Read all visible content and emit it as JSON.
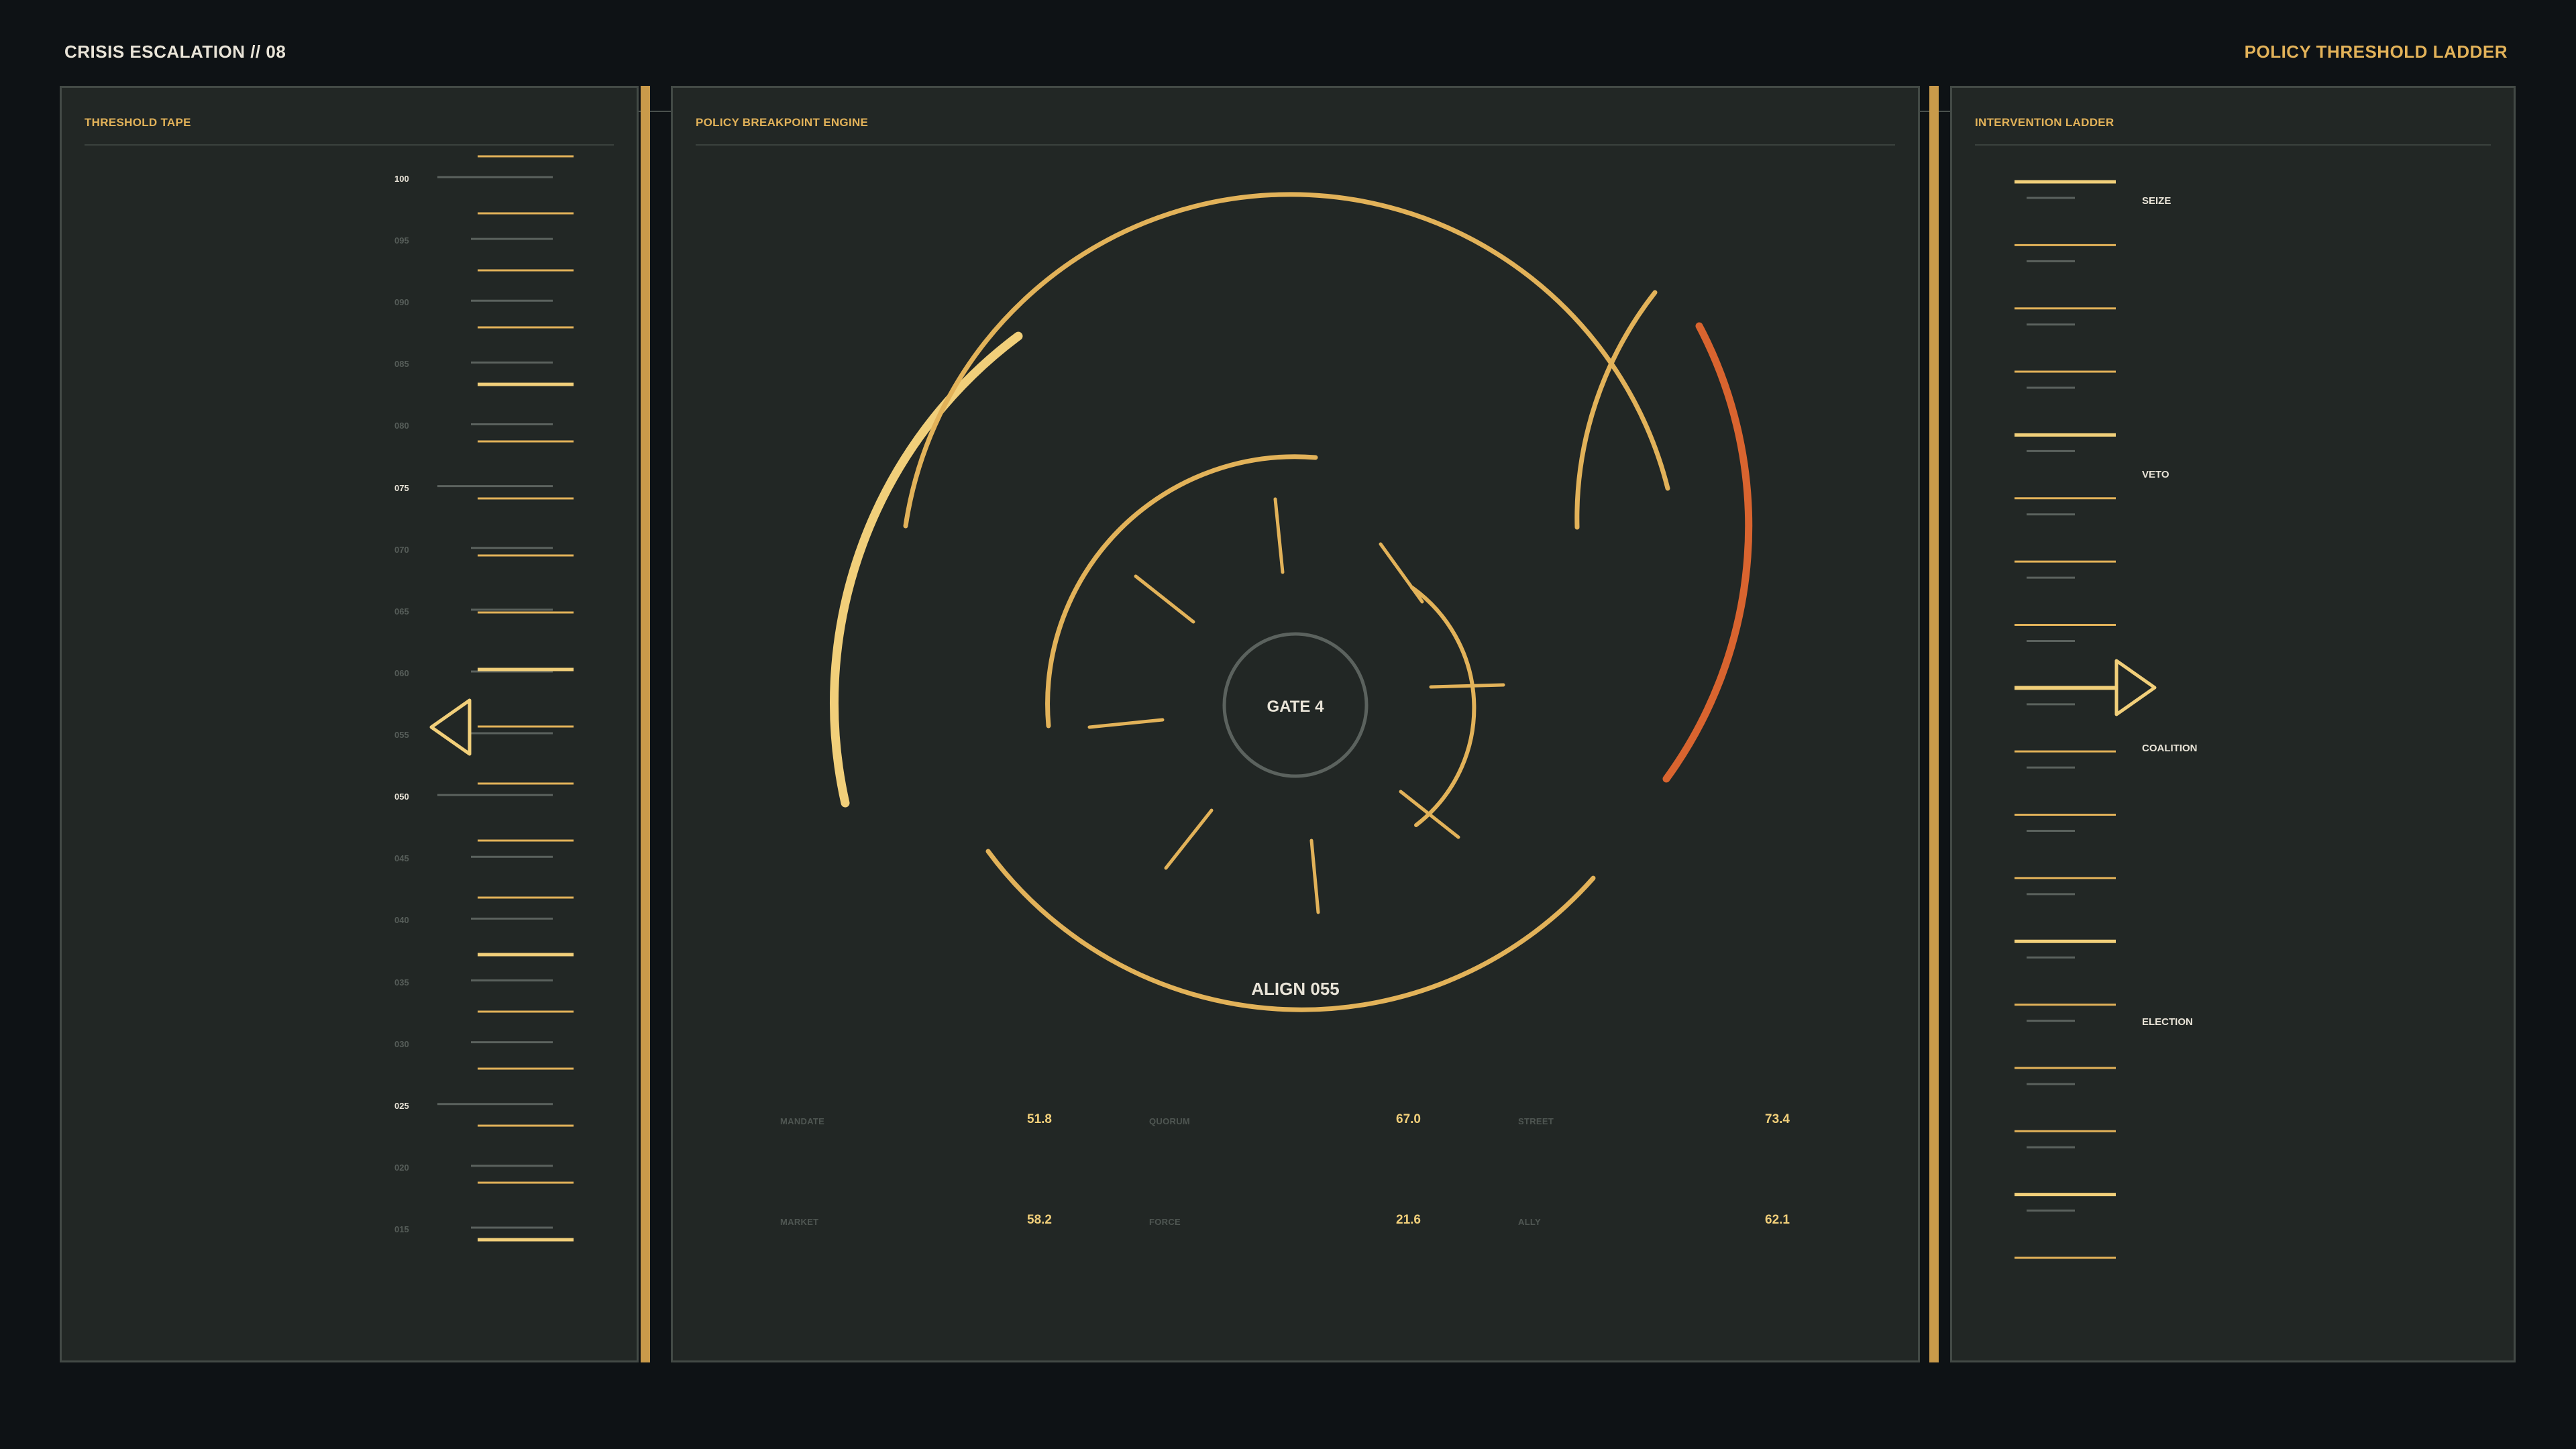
{
  "header": {
    "title": "CRISIS ESCALATION // 08",
    "right_title": "POLICY THRESHOLD LADDER"
  },
  "panels": {
    "threshold_tape": {
      "title": "THRESHOLD TAPE",
      "tick_labels": [
        "100",
        "095",
        "090",
        "085",
        "080",
        "075",
        "070",
        "065",
        "060",
        "055",
        "050",
        "045",
        "040",
        "035",
        "030",
        "025",
        "020",
        "015"
      ],
      "marker_value": 60
    },
    "breakpoint_engine": {
      "title": "POLICY BREAKPOINT ENGINE",
      "gate_label": "GATE 4",
      "align_label": "ALIGN 055",
      "metrics": [
        {
          "label": "MANDATE",
          "value": "51.8"
        },
        {
          "label": "QUORUM",
          "value": "67.0"
        },
        {
          "label": "STREET",
          "value": "73.4"
        },
        {
          "label": "MARKET",
          "value": "58.2"
        },
        {
          "label": "FORCE",
          "value": "21.6"
        },
        {
          "label": "ALLY",
          "value": "62.1"
        }
      ]
    },
    "intervention_ladder": {
      "title": "INTERVENTION LADDER",
      "rungs": [
        "SEIZE",
        "VETO",
        "COALITION",
        "ELECTION"
      ]
    }
  },
  "colors": {
    "accent": "#e2b259",
    "accent_light": "#f1cf7a",
    "alert": "#d9642f",
    "panel_bg": "#222725",
    "page_bg": "#0e1215",
    "muted": "#5b625e"
  }
}
